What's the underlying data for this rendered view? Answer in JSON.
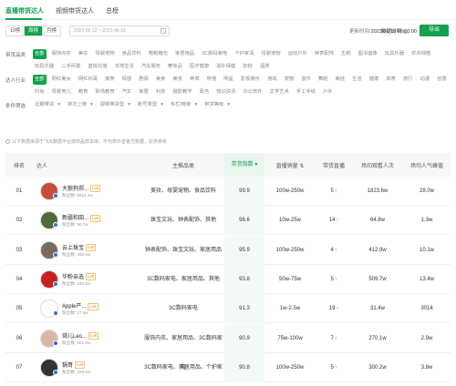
{
  "tabs": [
    {
      "label": "直播带货达人",
      "active": true
    },
    {
      "label": "视频带货达人",
      "active": false
    },
    {
      "label": "总榜",
      "active": false
    }
  ],
  "period_tabs": [
    {
      "label": "日榜",
      "active": false
    },
    {
      "label": "周榜",
      "active": true
    },
    {
      "label": "月榜",
      "active": false
    }
  ],
  "date_range": "2023-06-12 ~ 2023-06-18",
  "update_label": "更新时间:",
  "update_time": "2023/06/19 08:00:00",
  "explain_label": "数据说明",
  "export_label": "导出",
  "filters": [
    {
      "label": "带货品类",
      "options": [
        "全部",
        "服饰内衣",
        "美妆",
        "母婴宠物",
        "食品饮料",
        "鞋靴箱包",
        "家居用品",
        "3C数码家电",
        "个护家清",
        "母婴宠物",
        "运动户外",
        "钟表配饰",
        "生鲜",
        "图书音像",
        "玩具乐器",
        "农资绿植",
        "玩具乐器",
        "二手闲置",
        "虚拟充值",
        "本地生活",
        "汽车服务",
        "奢侈品",
        "医疗健康",
        "滋补保健",
        "奶粉",
        "酒类"
      ],
      "selected": 0
    },
    {
      "label": "达人行业",
      "options": [
        "全部",
        "网红美女",
        "网红帅哥",
        "搞笑",
        "情感",
        "剧情",
        "美食",
        "美妆",
        "种草",
        "穿搭",
        "明星",
        "影视娱乐",
        "游戏",
        "宠物",
        "音乐",
        "舞蹈",
        "萌娃",
        "生活",
        "健康",
        "体育",
        "旅行",
        "动漫",
        "创意",
        "时尚",
        "母婴育儿",
        "教育",
        "职场教育",
        "汽车",
        "家居",
        "科技",
        "摄影教学",
        "政务",
        "知识资讯",
        "办公软件",
        "文学艺术",
        "手工手绘",
        "户外"
      ],
      "selected": 0
    },
    {
      "label": "条件筛选",
      "options": [
        "近期带货",
        "排次上榜",
        "视频带货型",
        "账号类型",
        "专栏/榜单",
        "带货等级"
      ],
      "selected": -1
    }
  ],
  "note": "以下数据来源于飞瓜数据平台按商品样本库，不代表抖音官方数据，仅供参考",
  "table": {
    "columns": [
      "排名",
      "达人",
      "主推品类",
      "带货指数",
      "直播销量",
      "带货直播",
      "场均观看人次",
      "场均人气峰值"
    ],
    "sorted_column": 3,
    "fans_label": "粉丝数:",
    "rows": [
      {
        "rank": "01",
        "name": "大狼狗郑...",
        "level": "Lv6",
        "fans": "5824.4w",
        "category": "美妆、母婴宠物、食品饮料",
        "index": "99.9",
        "sales": "100w-250w",
        "lives": "5",
        "views": "1823.6w",
        "peak": "28.0w",
        "avatar_color": "#c94b3a"
      },
      {
        "rank": "02",
        "name": "新疆和田...",
        "level": "Lv6",
        "fans": "90.7w",
        "category": "珠宝文玩、钟表配饰、其他",
        "index": "98.6",
        "sales": "10w-25w",
        "lives": "14",
        "views": "64.8w",
        "peak": "1.3w",
        "avatar_color": "#4f6b3a"
      },
      {
        "rank": "03",
        "name": "云上珠宝",
        "level": "Lv6",
        "fans": "302.6w",
        "category": "钟表配饰、珠宝文玩、家居用品",
        "index": "95.9",
        "sales": "100w-250w",
        "lives": "4",
        "views": "412.9w",
        "peak": "10.1w",
        "avatar_color": "#7a6a5a"
      },
      {
        "rank": "04",
        "name": "华粉亲选",
        "level": "Lv6",
        "fans": "232.8w",
        "category": "3C数码家电、家居用品、其他",
        "index": "93.8",
        "sales": "50w-75w",
        "lives": "5",
        "views": "509.7w",
        "peak": "13.4w",
        "avatar_color": "#c8201e"
      },
      {
        "rank": "05",
        "name": "Apple产...",
        "level": "Lv6",
        "fans": "27.5w",
        "category": "3C数码家电",
        "index": "91.3",
        "sales": "1w-2.5w",
        "lives": "19",
        "views": "31.4w",
        "peak": "3014",
        "avatar_color": "#ffffff"
      },
      {
        "rank": "06",
        "name": "琦儿Leo...",
        "level": "Lv6",
        "fans": "501.9w",
        "category": "服饰内衣、家居用品、3C数码家电",
        "index": "90.9",
        "sales": "75w-100w",
        "lives": "7",
        "views": "270.1w",
        "peak": "2.9w",
        "avatar_color": "#d9b7a8"
      },
      {
        "rank": "07",
        "name": "锅哥",
        "level": "Lv6",
        "fans": "208.6w",
        "category": "3C数码家电、家居用品、个护家清",
        "index": "90.8",
        "sales": "100w-250w",
        "lives": "5",
        "views": "300.2w",
        "peak": "3.8w",
        "avatar_color": "#333333"
      }
    ]
  },
  "colors": {
    "accent": "#12a14e",
    "level": "#e08a00"
  }
}
